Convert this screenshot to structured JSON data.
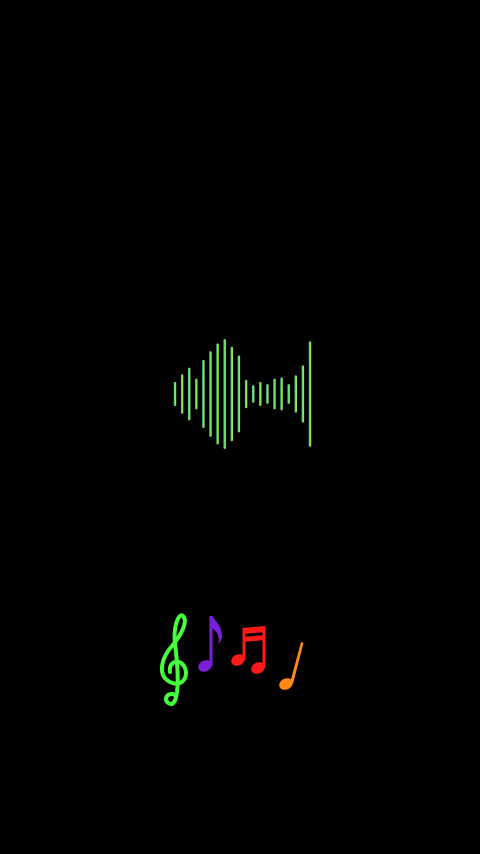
{
  "screen": {
    "background": "#000000"
  },
  "waveform": {
    "icon": "audio-waveform-icon",
    "gradient": [
      "#3fd6a0",
      "#6ee05a",
      "#c9e63a"
    ],
    "bar_levels": [
      0.22,
      0.36,
      0.48,
      0.28,
      0.62,
      0.78,
      0.92,
      1.0,
      0.86,
      0.7,
      0.26,
      0.16,
      0.22,
      0.18,
      0.28,
      0.3,
      0.18,
      0.34,
      0.52,
      0.96
    ]
  },
  "music_notes": [
    {
      "icon": "treble-clef-icon",
      "color": "#44ff3a"
    },
    {
      "icon": "eighth-note-icon",
      "color": "#7a1fd8"
    },
    {
      "icon": "beamed-sixteenth-notes-icon",
      "color": "#ff1a1a"
    },
    {
      "icon": "quarter-note-icon",
      "color": "#ff8a1a"
    }
  ]
}
